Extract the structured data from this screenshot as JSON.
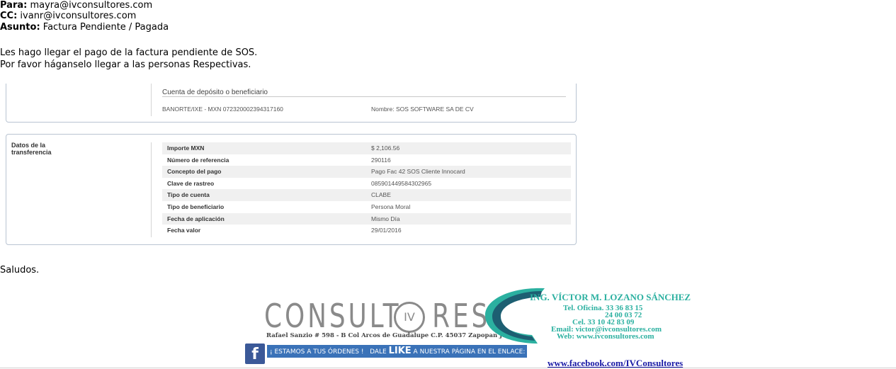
{
  "email": {
    "to_label": "Para:",
    "to_value": "mayra@ivconsultores.com",
    "cc_label": "CC:",
    "cc_value": "ivanr@ivconsultores.com",
    "subject_label": "Asunto:",
    "subject_value": "Factura Pendiente / Pagada",
    "body_line1": "Les hago llegar el pago de la factura pendiente de SOS.",
    "body_line2": "Por favor háganselo llegar a las personas Respectivas.",
    "closing": "Saludos."
  },
  "receipt": {
    "beneficiary_title": "Cuenta de depósito o beneficiario",
    "account": "BANORTE/IXE - MXN 072320002394317160",
    "beneficiary_name": "Nombre: SOS SOFTWARE SA DE CV",
    "transfer_label": "Datos de la transferencia",
    "rows": [
      {
        "key": "Importe MXN",
        "value": "$ 2,106.56"
      },
      {
        "key": "Número de referencia",
        "value": "290116"
      },
      {
        "key": "Concepto del pago",
        "value": "Pago Fac 42 SOS Cliente Innocard"
      },
      {
        "key": "Clave de rastreo",
        "value": "085901449584302965"
      },
      {
        "key": "Tipo de cuenta",
        "value": "CLABE"
      },
      {
        "key": "Tipo de beneficiario",
        "value": "Persona Moral"
      },
      {
        "key": "Fecha de aplicación",
        "value": "Mismo Día"
      },
      {
        "key": "Fecha valor",
        "value": "29/01/2016"
      }
    ]
  },
  "signature": {
    "logo_text": "CONSULTORES",
    "logo_left": "CONSULT",
    "logo_right": "RES",
    "logo_badge": "IV",
    "address": "Rafael Sanzio # 598 - B Col Arcos de Guadalupe C.P. 45037 Zapopan Jal.",
    "name": "ING. VÍCTOR M. LOZANO SÁNCHEZ",
    "phone_office": "Tel. Oficina. 33 36 83 15",
    "phone_office2": "24 00 03 72",
    "cell": "Cel. 33 10 42 83 09",
    "email": "Email: victor@ivconsultores.com",
    "web": "Web: www.ivconsultores.com",
    "fb_banner_a": "¡ ESTAMOS A TUS ÓRDENES !",
    "fb_banner_b": "DALE",
    "fb_banner_like": "LIKE",
    "fb_banner_c": "A NUESTRA PÁGINA EN EL ENLACE:",
    "fb_link": "www.facebook.com/IVConsultores",
    "fb_icon": "f"
  },
  "colors": {
    "accent_teal": "#2bb0a0",
    "fb_blue": "#3b5998",
    "link_blue": "#1a1aa6"
  }
}
